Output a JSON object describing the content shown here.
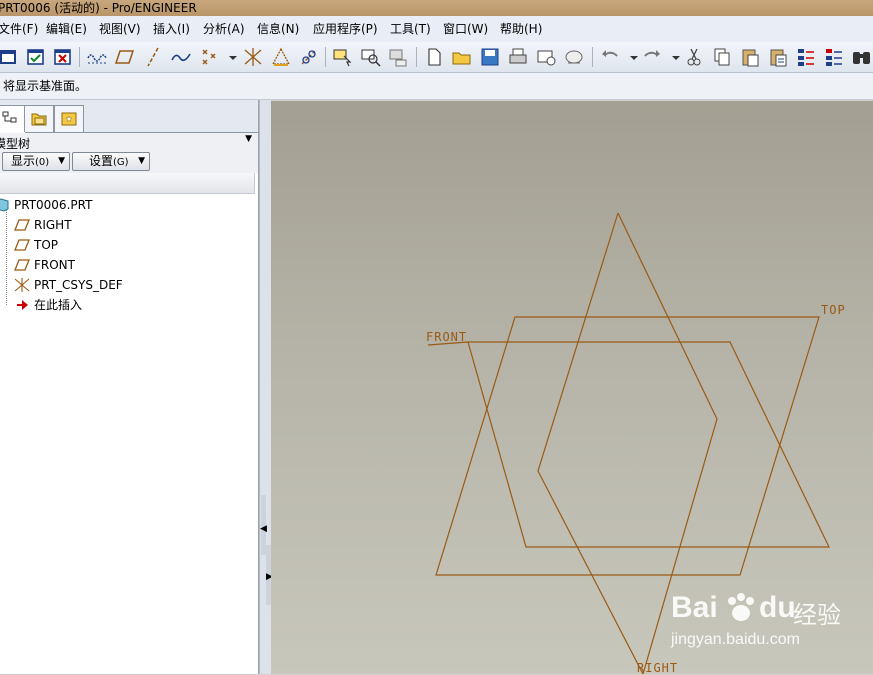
{
  "window": {
    "title": "PRT0006 (活动的) - Pro/ENGINEER"
  },
  "menu": [
    {
      "label": "文件(F)"
    },
    {
      "label": "编辑(E)"
    },
    {
      "label": "视图(V)"
    },
    {
      "label": "插入(I)"
    },
    {
      "label": "分析(A)"
    },
    {
      "label": "信息(N)"
    },
    {
      "label": "应用程序(P)"
    },
    {
      "label": "工具(T)"
    },
    {
      "label": "窗口(W)"
    },
    {
      "label": "帮助(H)"
    }
  ],
  "message": "将显示基准面。",
  "model_tree": {
    "title": "模型树",
    "show_button": "显示",
    "show_key": "(0)",
    "settings_button": "设置",
    "settings_key": "(G)",
    "items": [
      {
        "label": "PRT0006.PRT",
        "icon": "part-icon"
      },
      {
        "label": "RIGHT",
        "icon": "datum-plane-icon"
      },
      {
        "label": "TOP",
        "icon": "datum-plane-icon"
      },
      {
        "label": "FRONT",
        "icon": "datum-plane-icon"
      },
      {
        "label": "PRT_CSYS_DEF",
        "icon": "csys-icon"
      },
      {
        "label": "在此插入",
        "icon": "insert-here-arrow-icon"
      }
    ]
  },
  "viewport": {
    "labels": {
      "front": "FRONT",
      "top": "TOP",
      "right": "RIGHT"
    },
    "line_color": "#9a5a14"
  },
  "watermark": {
    "brand": "Bai",
    "brand2": "du",
    "cn": "经验",
    "url": "jingyan.baidu.com"
  }
}
